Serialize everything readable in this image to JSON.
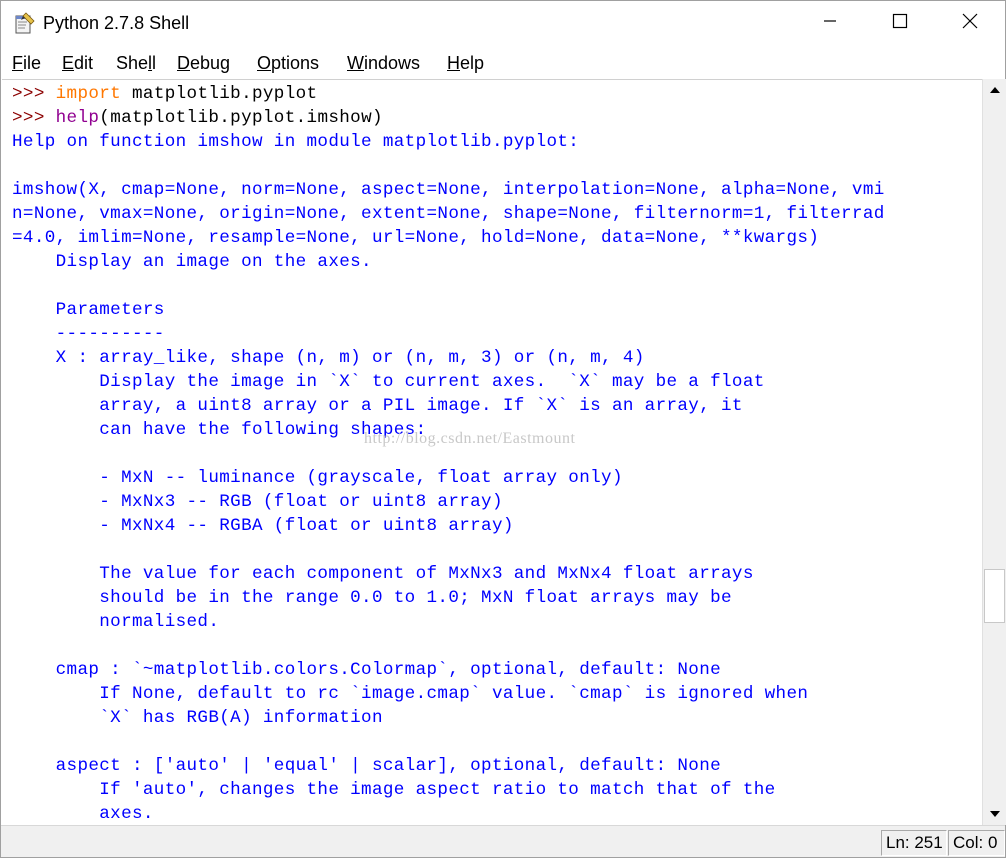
{
  "window": {
    "title": "Python 2.7.8 Shell",
    "icon": "idle-python-icon"
  },
  "controls": {
    "minimize": "minimize-icon",
    "maximize": "maximize-icon",
    "close": "close-icon"
  },
  "menu": [
    {
      "label": "File",
      "accel": "F",
      "rest": "ile"
    },
    {
      "label": "Edit",
      "accel": "E",
      "rest": "dit"
    },
    {
      "label": "Shell",
      "pre": "She",
      "accel": "l",
      "rest": "l"
    },
    {
      "label": "Debug",
      "accel": "D",
      "rest": "ebug"
    },
    {
      "label": "Options",
      "accel": "O",
      "rest": "ptions"
    },
    {
      "label": "Windows",
      "accel": "W",
      "rest": "indows"
    },
    {
      "label": "Help",
      "accel": "H",
      "rest": "elp"
    }
  ],
  "shell": {
    "prompt": ">>> ",
    "cmd1_keyword": "import",
    "cmd1_rest": " matplotlib.pyplot",
    "cmd2_builtin": "help",
    "cmd2_rest": "(matplotlib.pyplot.imshow)",
    "output": [
      "Help on function imshow in module matplotlib.pyplot:",
      "",
      "imshow(X, cmap=None, norm=None, aspect=None, interpolation=None, alpha=None, vmi",
      "n=None, vmax=None, origin=None, extent=None, shape=None, filternorm=1, filterrad",
      "=4.0, imlim=None, resample=None, url=None, hold=None, data=None, **kwargs)",
      "    Display an image on the axes.",
      "",
      "    Parameters",
      "    ----------",
      "    X : array_like, shape (n, m) or (n, m, 3) or (n, m, 4)",
      "        Display the image in `X` to current axes.  `X` may be a float",
      "        array, a uint8 array or a PIL image. If `X` is an array, it",
      "        can have the following shapes:",
      "",
      "        - MxN -- luminance (grayscale, float array only)",
      "        - MxNx3 -- RGB (float or uint8 array)",
      "        - MxNx4 -- RGBA (float or uint8 array)",
      "",
      "        The value for each component of MxNx3 and MxNx4 float arrays",
      "        should be in the range 0.0 to 1.0; MxN float arrays may be",
      "        normalised.",
      "",
      "    cmap : `~matplotlib.colors.Colormap`, optional, default: None",
      "        If None, default to rc `image.cmap` value. `cmap` is ignored when",
      "        `X` has RGB(A) information",
      "",
      "    aspect : ['auto' | 'equal' | scalar], optional, default: None",
      "        If 'auto', changes the image aspect ratio to match that of the",
      "        axes."
    ],
    "watermark": "http://blog.csdn.net/Eastmount"
  },
  "scrollbar": {
    "up": "scroll-up-arrow-icon",
    "down": "scroll-down-arrow-icon",
    "position_fraction": 0.68
  },
  "status": {
    "ln": "Ln: 251",
    "col": "Col: 0"
  },
  "colors": {
    "prompt": "#8b0000",
    "keyword": "#ff7700",
    "builtin": "#900090",
    "stdout": "#0000ff"
  }
}
